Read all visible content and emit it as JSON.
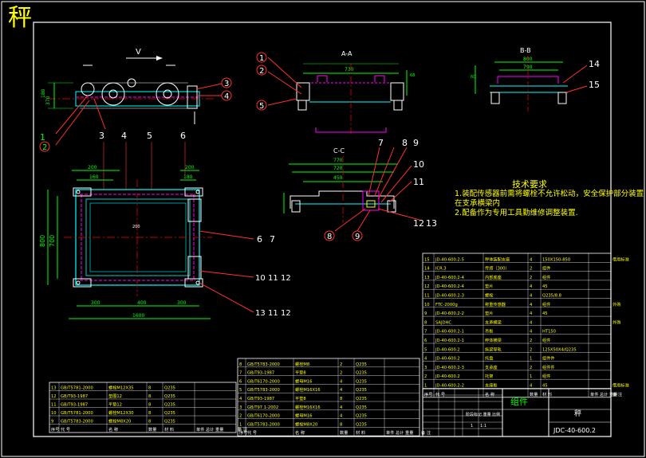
{
  "corner_title": "秤",
  "view_labels": {
    "view_v": "V",
    "section_a": "A-A",
    "section_b": "B-B",
    "section_c": "C-C"
  },
  "dimensions": {
    "aa_top": "730",
    "bb_top": [
      "800",
      "790"
    ],
    "cc": [
      "770",
      "720",
      "450"
    ],
    "plan_top": [
      "200",
      "160",
      "200",
      "180"
    ],
    "plan_bottom": [
      "300",
      "400",
      "300"
    ],
    "plan_total": "1600",
    "plan_left": [
      "800",
      "700"
    ],
    "side_left": [
      "180",
      "370"
    ]
  },
  "balloons": {
    "front": [
      "1",
      "2",
      "3",
      "4"
    ],
    "plan": [
      "3",
      "4",
      "5",
      "6"
    ],
    "plan_right": [
      "6",
      "7",
      "10",
      "11",
      "12",
      "13",
      "11",
      "12"
    ],
    "aa": [
      "1",
      "2",
      "5"
    ],
    "bb": [
      "14",
      "15"
    ],
    "cc": [
      "7",
      "8",
      "9",
      "10",
      "11",
      "8",
      "9",
      "12",
      "13"
    ]
  },
  "tech_requirements": {
    "heading": "技术要求",
    "lines": [
      "1.装配传感器前需将螺栓不允许松动，安全保护部分装置在支承横梁内",
      "2.配备作为专用工具勤维修调整装置."
    ]
  },
  "parts_right": [
    [
      "15",
      "JD-40-600.2-5",
      "秤体装配支座",
      "4",
      "150X150-850",
      "",
      "借用标准"
    ],
    [
      "14",
      "ICR.3",
      "传感（300）",
      "2",
      "组件",
      "",
      ""
    ],
    [
      "13",
      "JD-40-600.2-4",
      "内部底座",
      "2",
      "组件",
      "",
      ""
    ],
    [
      "12",
      "JD-40-600.2-4",
      "垫片",
      "4",
      "45",
      "",
      ""
    ],
    [
      "11",
      "JD-40-600.2-3",
      "螺栓",
      "4",
      "Q235/8.8",
      "",
      ""
    ],
    [
      "10",
      "FTC-2000g",
      "称重传感器",
      "4",
      "组件",
      "",
      "外购"
    ],
    [
      "9",
      "JD-40-600.2-2",
      "垫片",
      "4",
      "45",
      "",
      ""
    ],
    [
      "8",
      "SAJDHC",
      "支承横梁",
      "4",
      "",
      "",
      "外购"
    ],
    [
      "7",
      "JD-40-600.2-1",
      "吊板",
      "4",
      "HT150",
      "",
      ""
    ],
    [
      "6",
      "JD-40-600.2-1",
      "秤体横梁",
      "2",
      "组件",
      "",
      ""
    ],
    [
      "5",
      "JD-40-600.2",
      "纵梁导轨",
      "2",
      "125X50X4/Q235",
      "",
      ""
    ],
    [
      "4",
      "JD-40-600.2",
      "托盘",
      "1",
      "组件件",
      "",
      ""
    ],
    [
      "3",
      "JD-40-600.2-3",
      "支承座",
      "2",
      "组件件",
      "",
      ""
    ],
    [
      "2",
      "JD-40-600.2",
      "托架",
      "1",
      "组件",
      "",
      ""
    ],
    [
      "1",
      "JD-40-600.2-2",
      "支座板",
      "4",
      "45",
      "",
      "借用标准"
    ]
  ],
  "parts_right_header": [
    "序号",
    "代 号",
    "名 称",
    "数量",
    "材 料",
    "单件 总计 重量",
    "备 注"
  ],
  "parts_mid": [
    [
      "8",
      "GB/T5783-2000",
      "螺栓M8",
      "2",
      "Q235",
      ""
    ],
    [
      "7",
      "GB/T93-1987",
      "平垫8",
      "2",
      "Q235",
      ""
    ],
    [
      "6",
      "GB/T6170-2000",
      "螺母M16",
      "4",
      "Q235",
      ""
    ],
    [
      "5",
      "GB/T5783-2000",
      "螺栓M16X16",
      "4",
      "Q235",
      ""
    ],
    [
      "4",
      "GB/T93-1987",
      "平垫8",
      "8",
      "Q235",
      ""
    ],
    [
      "3",
      "GB/T97.1-2002",
      "螺栓M16X16",
      "4",
      "Q235",
      ""
    ],
    [
      "2",
      "GB/T6170-2000",
      "螺母M16",
      "4",
      "Q235",
      ""
    ],
    [
      "1",
      "GB/T5783-2000",
      "螺栓M8X20",
      "8",
      "Q235",
      ""
    ]
  ],
  "parts_mid_header": [
    "序号",
    "代 号",
    "名 称",
    "数量",
    "材 料",
    "单件 总计 重量",
    "备 注"
  ],
  "parts_left": [
    [
      "13",
      "GB/T5781-2000",
      "螺栓M12X35",
      "8",
      "Q235",
      ""
    ],
    [
      "12",
      "GB/T93-1987",
      "垫圈12",
      "8",
      "Q235",
      ""
    ],
    [
      "11",
      "GB/T93-1987",
      "平垫12",
      "8",
      "Q235",
      ""
    ],
    [
      "10",
      "GB/T5781-2000",
      "螺栓M12X30",
      "8",
      "Q235",
      ""
    ],
    [
      "9",
      "GB/T5783-2000",
      "螺栓M8X20",
      "8",
      "Q235",
      ""
    ]
  ],
  "parts_left_header": [
    "序号",
    "代 号",
    "名 称",
    "数量",
    "材 料",
    "单件 总计 重量",
    "备 注"
  ],
  "title_block": {
    "part_name": "组件",
    "product": "秤",
    "drawing_no": "JDC-40-600.2",
    "scale": "1:1",
    "qty": "1",
    "stage_header": "阶段标记 重量 比例"
  },
  "colors": {
    "background": "#000000",
    "frame": "#ffffff",
    "outline": "#00ffff",
    "dims": "#00ff00",
    "balloons": "#ff3030",
    "hidden": "#ff00ff",
    "text_yellow": "#ffff00",
    "center": "#ff0000"
  }
}
